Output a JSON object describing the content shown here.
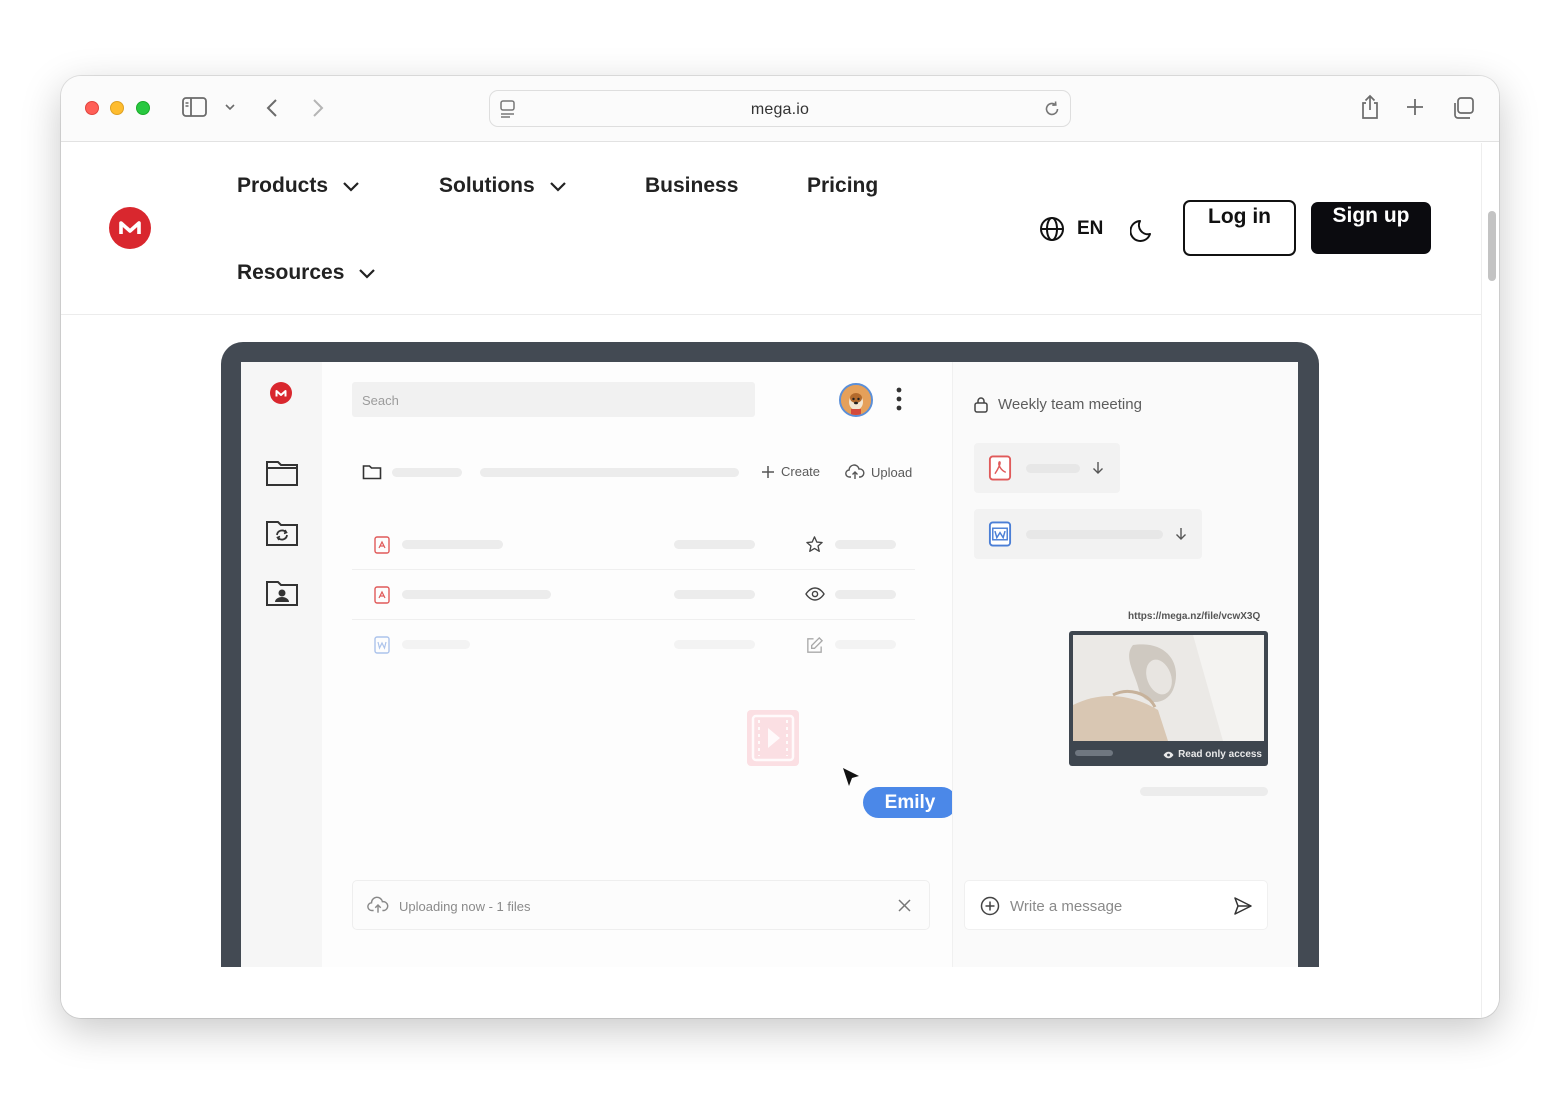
{
  "browser": {
    "url": "mega.io"
  },
  "nav": {
    "items": [
      {
        "label": "Products"
      },
      {
        "label": "Solutions"
      },
      {
        "label": "Business"
      },
      {
        "label": "Pricing"
      },
      {
        "label": "Resources"
      }
    ],
    "language": "EN",
    "login_label": "Log in",
    "signup_label": "Sign up"
  },
  "app": {
    "search_placeholder": "Seach",
    "create_label": "Create",
    "upload_label": "Upload",
    "upload_status": "Uploading now - 1 files",
    "cursor_user": "Emily",
    "chat_title": "Weekly team meeting",
    "share_link": "https://mega.nz/file/vcwX3Q",
    "preview_access": "Read only access",
    "message_placeholder": "Write a message"
  },
  "colors": {
    "brand_red": "#d9272e",
    "device_frame": "#434a53",
    "cursor_badge": "#4b88e8",
    "signup_bg": "#0b0b0f"
  }
}
